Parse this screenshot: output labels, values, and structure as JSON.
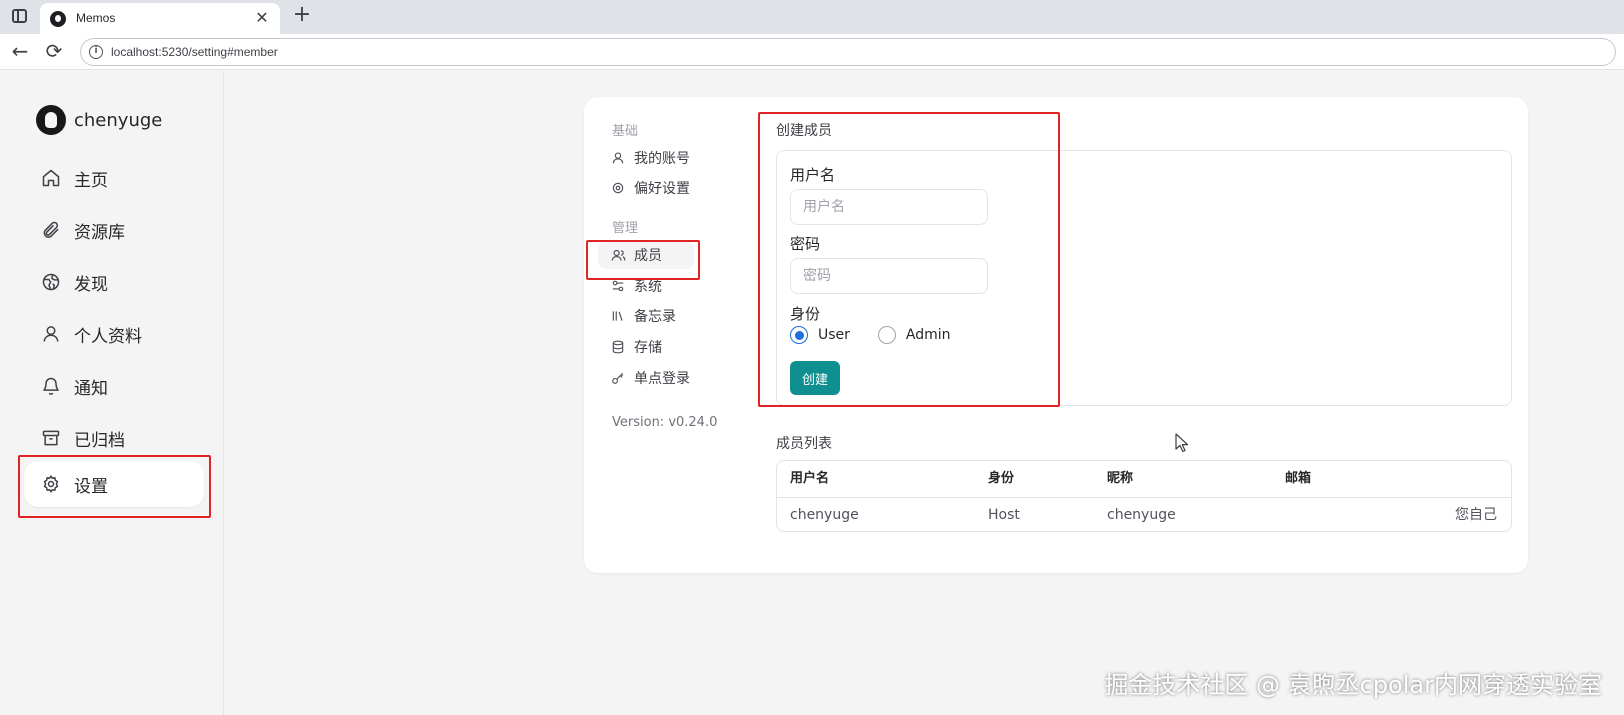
{
  "browser": {
    "tab_title": "Memos",
    "tab_close": "✕",
    "new_tab": "+",
    "back": "←",
    "reload": "⟳",
    "url": "localhost:5230/setting#member"
  },
  "sidebar": {
    "username": "chenyuge",
    "items": [
      {
        "label": "主页",
        "icon": "home-icon"
      },
      {
        "label": "资源库",
        "icon": "paperclip-icon"
      },
      {
        "label": "发现",
        "icon": "globe-icon"
      },
      {
        "label": "个人资料",
        "icon": "user-icon"
      },
      {
        "label": "通知",
        "icon": "bell-icon"
      },
      {
        "label": "已归档",
        "icon": "archive-icon"
      },
      {
        "label": "设置",
        "icon": "gear-icon",
        "active": true
      }
    ]
  },
  "settings_nav": {
    "group_basic": "基础",
    "my_account": "我的账号",
    "preferences": "偏好设置",
    "group_admin": "管理",
    "members": "成员",
    "system": "系统",
    "memos": "备忘录",
    "storage": "存储",
    "sso": "单点登录",
    "version": "Version: v0.24.0"
  },
  "create_member": {
    "title": "创建成员",
    "username_label": "用户名",
    "username_placeholder": "用户名",
    "password_label": "密码",
    "password_placeholder": "密码",
    "role_label": "身份",
    "role_options": [
      "User",
      "Admin"
    ],
    "role_selected": "User",
    "create_button": "创建"
  },
  "member_list": {
    "title": "成员列表",
    "columns": [
      "用户名",
      "身份",
      "昵称",
      "邮箱"
    ],
    "rows": [
      {
        "username": "chenyuge",
        "role": "Host",
        "nickname": "chenyuge",
        "email": "",
        "action": "您自己"
      }
    ]
  },
  "watermark": "掘金技术社区 @ 袁煦丞cpolar内网穿透实验室",
  "colors": {
    "accent_button": "#0f8f8f",
    "radio_selected": "#1d6fe0",
    "annotation_red": "#e02424"
  }
}
